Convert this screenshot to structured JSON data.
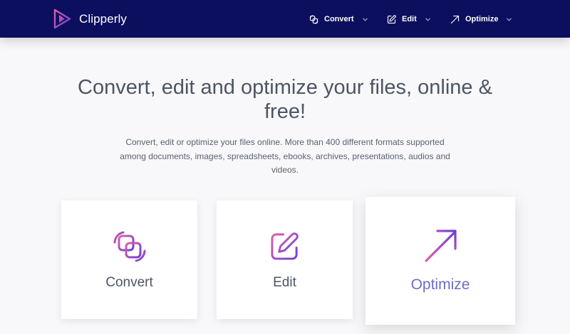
{
  "brand": {
    "name": "Clipperly"
  },
  "nav": {
    "items": [
      {
        "label": "Convert",
        "icon": "convert-icon"
      },
      {
        "label": "Edit",
        "icon": "edit-icon"
      },
      {
        "label": "Optimize",
        "icon": "arrow-up-right-icon"
      }
    ]
  },
  "hero": {
    "title": "Convert, edit and optimize your files, online & free!",
    "description": "Convert, edit or optimize your files online. More than 400 different formats supported among documents, images, spreadsheets, ebooks, archives, presentations, audios and videos."
  },
  "cards": [
    {
      "label": "Convert",
      "icon": "convert-icon"
    },
    {
      "label": "Edit",
      "icon": "edit-icon"
    },
    {
      "label": "Optimize",
      "icon": "arrow-up-right-icon"
    }
  ],
  "colors": {
    "navbar": "#0c0f5e",
    "gradient_start": "#e05fa7",
    "gradient_end": "#6b3fd6",
    "active_card_label": "#6a6fc8",
    "page_bg": "#f8f8fa"
  }
}
